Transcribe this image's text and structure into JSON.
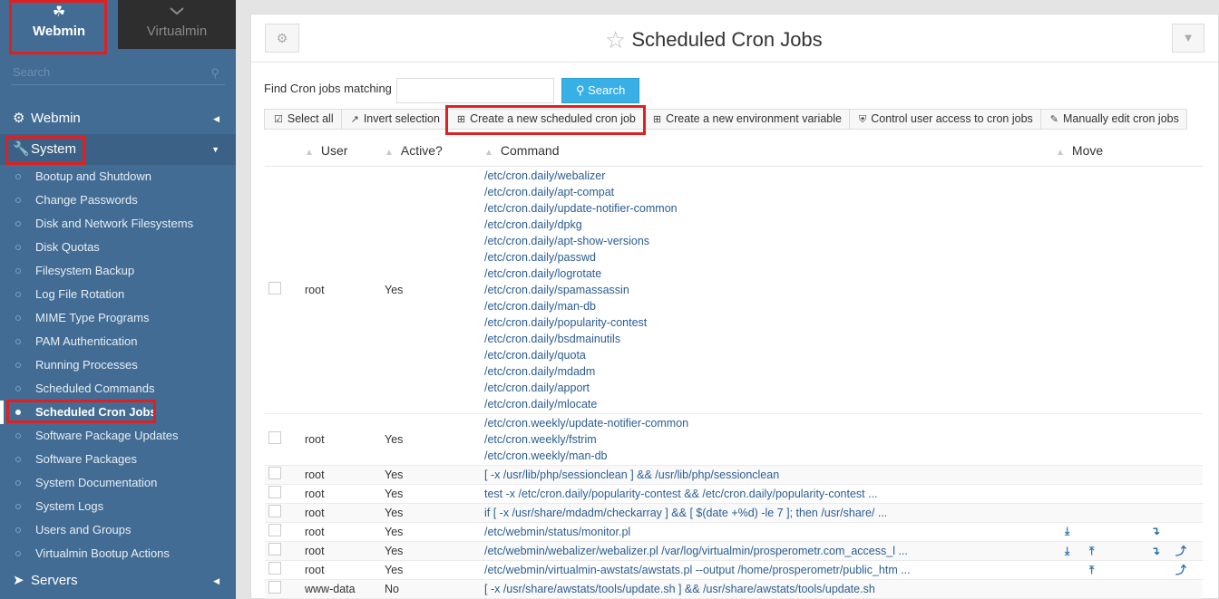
{
  "sidebar": {
    "tabs": {
      "webmin": "Webmin",
      "virtualmin": "Virtualmin"
    },
    "search_placeholder": "Search",
    "sections": {
      "webmin": "Webmin",
      "system": "System",
      "servers": "Servers"
    },
    "items": [
      "Bootup and Shutdown",
      "Change Passwords",
      "Disk and Network Filesystems",
      "Disk Quotas",
      "Filesystem Backup",
      "Log File Rotation",
      "MIME Type Programs",
      "PAM Authentication",
      "Running Processes",
      "Scheduled Commands",
      "Scheduled Cron Jobs",
      "Software Package Updates",
      "Software Packages",
      "System Documentation",
      "System Logs",
      "Users and Groups",
      "Virtualmin Bootup Actions"
    ],
    "active_item": "Scheduled Cron Jobs"
  },
  "header": {
    "title": "Scheduled Cron Jobs"
  },
  "search": {
    "label": "Find Cron jobs matching",
    "value": "",
    "button": "Search"
  },
  "actions": {
    "select_all": "Select all",
    "invert_selection": "Invert selection",
    "create_job": "Create a new scheduled cron job",
    "create_env": "Create a new environment variable",
    "control_access": "Control user access to cron jobs",
    "manual_edit": "Manually edit cron jobs"
  },
  "table": {
    "headers": {
      "user": "User",
      "active": "Active?",
      "command": "Command",
      "move": "Move"
    },
    "rows": [
      {
        "user": "root",
        "active": "Yes",
        "commands": [
          "/etc/cron.daily/webalizer",
          "/etc/cron.daily/apt-compat",
          "/etc/cron.daily/update-notifier-common",
          "/etc/cron.daily/dpkg",
          "/etc/cron.daily/apt-show-versions",
          "/etc/cron.daily/passwd",
          "/etc/cron.daily/logrotate",
          "/etc/cron.daily/spamassassin",
          "/etc/cron.daily/man-db",
          "/etc/cron.daily/popularity-contest",
          "/etc/cron.daily/bsdmainutils",
          "/etc/cron.daily/quota",
          "/etc/cron.daily/mdadm",
          "/etc/cron.daily/apport",
          "/etc/cron.daily/mlocate"
        ]
      },
      {
        "user": "root",
        "active": "Yes",
        "commands": [
          "/etc/cron.weekly/update-notifier-common",
          "/etc/cron.weekly/fstrim",
          "/etc/cron.weekly/man-db"
        ]
      },
      {
        "user": "root",
        "active": "Yes",
        "commands": [
          "[ -x /usr/lib/php/sessionclean ] && /usr/lib/php/sessionclean"
        ]
      },
      {
        "user": "root",
        "active": "Yes",
        "commands": [
          "test -x /etc/cron.daily/popularity-contest && /etc/cron.daily/popularity-contest ..."
        ]
      },
      {
        "user": "root",
        "active": "Yes",
        "commands": [
          "if [ -x /usr/share/mdadm/checkarray ] && [ $(date +%d) -le 7 ]; then /usr/share/ ..."
        ]
      },
      {
        "user": "root",
        "active": "Yes",
        "commands": [
          "/etc/webmin/status/monitor.pl"
        ],
        "move": {
          "down": true,
          "up": false,
          "down2": true,
          "up2": false
        }
      },
      {
        "user": "root",
        "active": "Yes",
        "commands": [
          "/etc/webmin/webalizer/webalizer.pl /var/log/virtualmin/prosperometr.com_access_l ..."
        ],
        "move": {
          "down": true,
          "up": true,
          "down2": true,
          "up2": true
        }
      },
      {
        "user": "root",
        "active": "Yes",
        "commands": [
          "/etc/webmin/virtualmin-awstats/awstats.pl --output /home/prosperometr/public_htm ..."
        ],
        "move": {
          "down": false,
          "up": true,
          "down2": false,
          "up2": true
        }
      },
      {
        "user": "www-data",
        "active": "No",
        "commands": [
          "[ -x /usr/share/awstats/tools/update.sh ] && /usr/share/awstats/tools/update.sh"
        ]
      }
    ]
  },
  "colors": {
    "sidebar_bg": "#426c94",
    "accent": "#38b0e6",
    "link": "#2a5c93",
    "highlight_box": "#e02020",
    "inactive": "#d02020"
  }
}
